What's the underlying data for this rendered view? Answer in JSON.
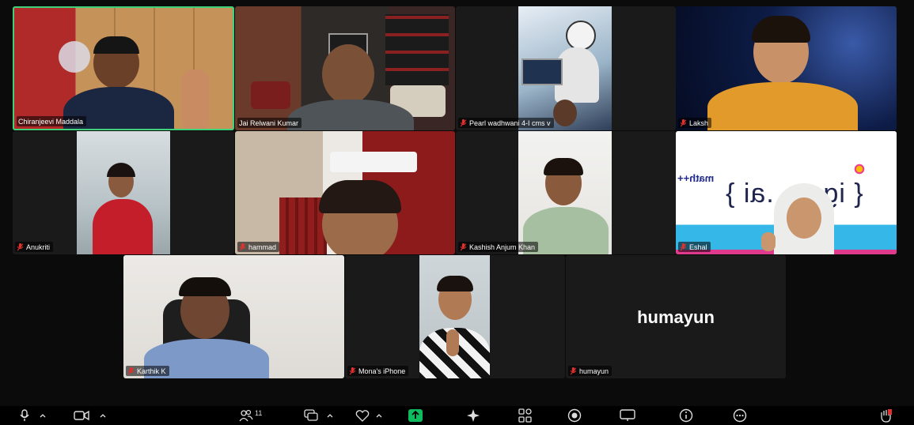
{
  "participants": [
    {
      "name": "Chiranjeevi Maddala",
      "muted": false,
      "active": true
    },
    {
      "name": "Jai Relwani Kumar",
      "muted": false,
      "active": false
    },
    {
      "name": "Pearl wadhwani 4-I cms v",
      "muted": true,
      "active": false
    },
    {
      "name": "Laksh",
      "muted": true,
      "active": false
    },
    {
      "name": "Anukriti",
      "muted": true,
      "active": false
    },
    {
      "name": "hammad",
      "muted": true,
      "active": false
    },
    {
      "name": "Kashish Anjum Khan",
      "muted": true,
      "active": false
    },
    {
      "name": "Eshal",
      "muted": true,
      "active": false
    },
    {
      "name": "Karthik K",
      "muted": true,
      "active": false
    },
    {
      "name": "Mona's iPhone",
      "muted": true,
      "active": false
    },
    {
      "name": "humayun",
      "muted": true,
      "active": false,
      "avatar_text": "humayun"
    }
  ],
  "background_text": {
    "math_label": "math++",
    "brand_text": "{ ige    .ai }"
  },
  "toolbar": {
    "participant_count": "11",
    "icons": [
      "mic-icon",
      "chevron-up-icon",
      "camera-icon",
      "chevron-up-icon",
      "participants-icon",
      "chat-icon",
      "chevron-up-icon",
      "react-icon",
      "chevron-up-icon",
      "share-icon",
      "ai-companion-icon",
      "apps-icon",
      "record-icon",
      "whiteboard-icon",
      "info-icon",
      "more-icon",
      "raise-hand-icon"
    ]
  },
  "colors": {
    "active_border": "#3fd07a",
    "muted_mic": "#e0312f",
    "share_green": "#0ebc5f"
  }
}
